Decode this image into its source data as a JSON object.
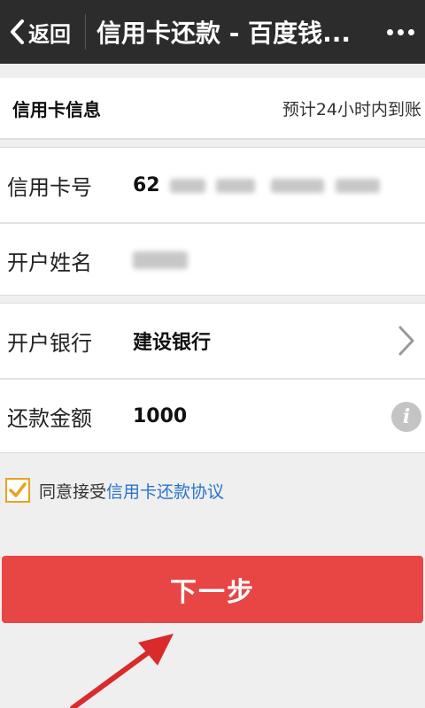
{
  "header": {
    "back_label": "返回",
    "title": "信用卡还款 - 百度钱..."
  },
  "section": {
    "title": "信用卡信息",
    "note": "预计24小时内到账"
  },
  "form": {
    "card_number": {
      "label": "信用卡号",
      "value_prefix": "62"
    },
    "holder_name": {
      "label": "开户姓名"
    },
    "bank": {
      "label": "开户银行",
      "value": "建设银行"
    },
    "amount": {
      "label": "还款金额",
      "value": "1000",
      "info_glyph": "i"
    }
  },
  "agreement": {
    "checked": true,
    "text": "同意接受",
    "link": "信用卡还款协议"
  },
  "next_button": {
    "label": "下一步"
  },
  "colors": {
    "topbar": "#2c2c2c",
    "button": "#e84545",
    "link": "#2a73c9",
    "checkbox": "#e8a31f",
    "annotation_arrow": "#d92b2b"
  },
  "icons": [
    "back-chevron-icon",
    "more-icon",
    "chevron-right-icon",
    "info-icon",
    "checkmark-icon",
    "annotation-arrow"
  ]
}
